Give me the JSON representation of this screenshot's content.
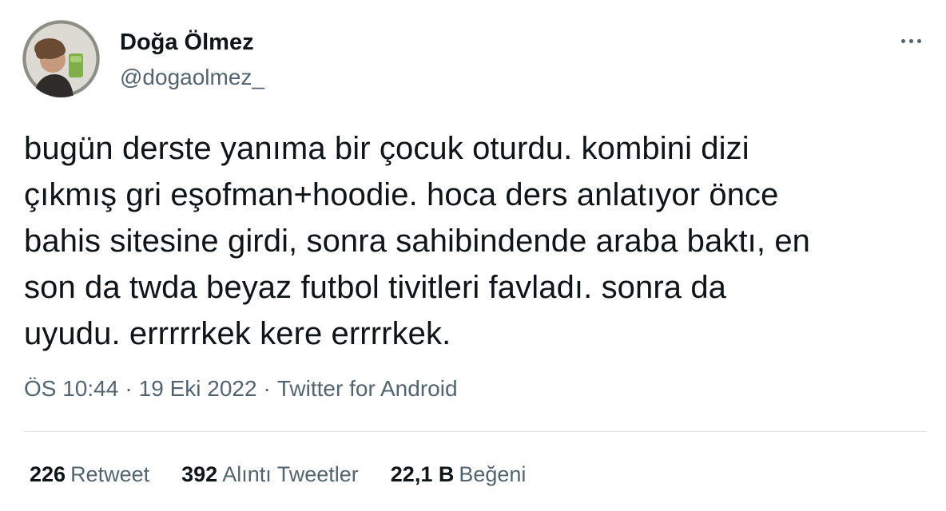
{
  "author": {
    "display_name": "Doğa Ölmez",
    "handle": "@dogaolmez_",
    "avatar_icon": "profile-photo"
  },
  "more_icon": "ellipsis-icon",
  "tweet": {
    "text": "bugün derste yanıma bir çocuk oturdu. kombini dizi\nçıkmış gri eşofman+hoodie. hoca ders anlatıyor önce\nbahis sitesine girdi, sonra sahibindende araba baktı, en\nson da twda beyaz futbol tivitleri favladı. sonra da\nuyudu. errrrrkek kere errrrkek."
  },
  "meta": {
    "time": "ÖS 10:44",
    "separator": "·",
    "date": "19 Eki 2022",
    "source": "Twitter for Android"
  },
  "stats": [
    {
      "count": "226",
      "label": "Retweet"
    },
    {
      "count": "392",
      "label": "Alıntı Tweetler"
    },
    {
      "count": "22,1 B",
      "label": "Beğeni"
    }
  ],
  "colors": {
    "text_primary": "#0f1419",
    "text_secondary": "#536471",
    "divider": "#e1e6ea"
  }
}
